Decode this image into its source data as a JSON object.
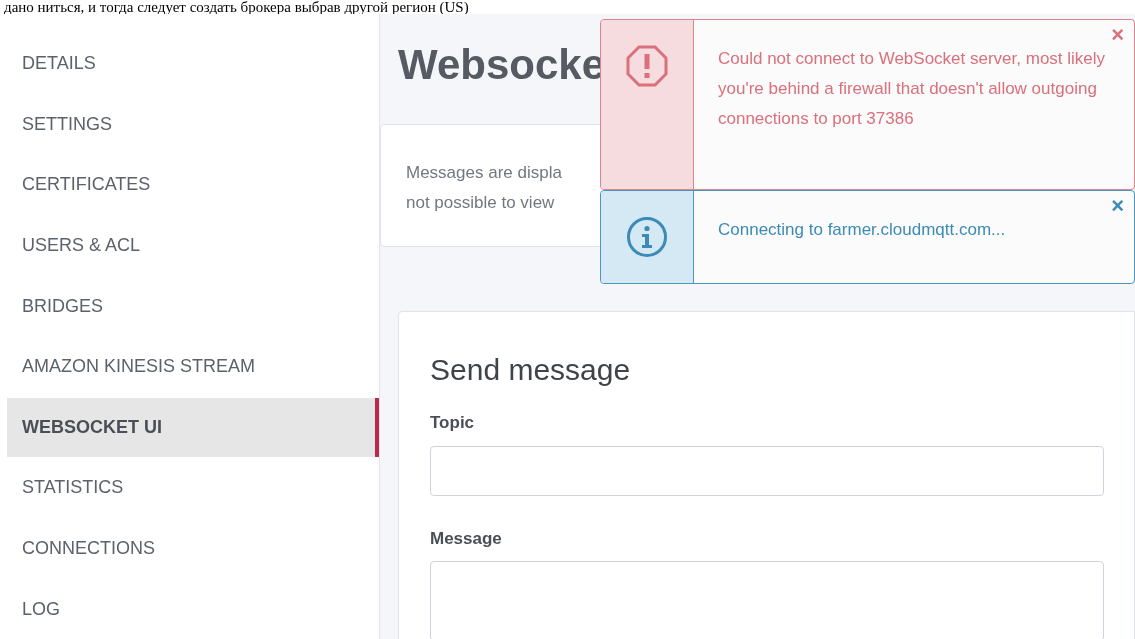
{
  "document_text": "дано ниться, и тогда следует создать брокера выбрав другой регион (US)",
  "sidebar": {
    "items": [
      {
        "label": "DETAILS",
        "selected": false
      },
      {
        "label": "SETTINGS",
        "selected": false
      },
      {
        "label": "CERTIFICATES",
        "selected": false
      },
      {
        "label": "USERS & ACL",
        "selected": false
      },
      {
        "label": "BRIDGES",
        "selected": false
      },
      {
        "label": "AMAZON KINESIS STREAM",
        "selected": false
      },
      {
        "label": "WEBSOCKET UI",
        "selected": true
      },
      {
        "label": "STATISTICS",
        "selected": false
      },
      {
        "label": "CONNECTIONS",
        "selected": false
      },
      {
        "label": "LOG",
        "selected": false
      }
    ]
  },
  "page_title": "Websocke",
  "description_lines": [
    "Messages are displa",
    "not possible to view"
  ],
  "notifications": [
    {
      "kind": "error",
      "message": "Could not connect to WebSocket server, most likely you're behind a firewall that doesn't allow outgoing connections to port 37386",
      "close": "×"
    },
    {
      "kind": "info",
      "message": "Connecting to farmer.cloudmqtt.com...",
      "close": "×"
    }
  ],
  "send_message": {
    "title": "Send message",
    "fields": [
      {
        "label": "Topic",
        "kind": "input"
      },
      {
        "label": "Message",
        "kind": "textarea"
      }
    ]
  }
}
